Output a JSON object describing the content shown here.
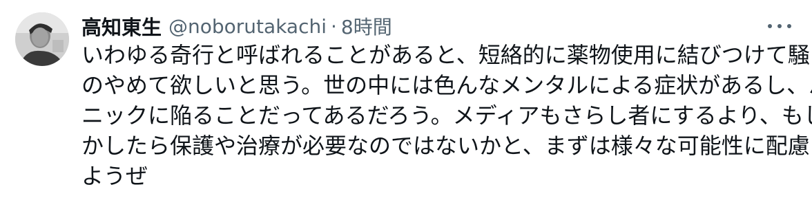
{
  "author": {
    "display_name": "高知東生",
    "handle": "@noborutakachi",
    "separator": "·",
    "timestamp": "8時間"
  },
  "more_icon": "more-horizontal-icon",
  "tweet": {
    "lines": [
      "いわゆる奇行と呼ばれることがあると、短絡的に薬物使用に結びつけて騒ぐ",
      "のやめて欲しいと思う。世の中には色んなメンタルによる症状があるし、パ",
      "ニックに陥ることだってあるだろう。メディアもさらし者にするより、もし",
      "かしたら保護や治療が必要なのではないかと、まずは様々な可能性に配慮し",
      "ようぜ"
    ]
  },
  "colors": {
    "text_primary": "#0f1419",
    "text_secondary": "#536471",
    "background": "#ffffff"
  }
}
